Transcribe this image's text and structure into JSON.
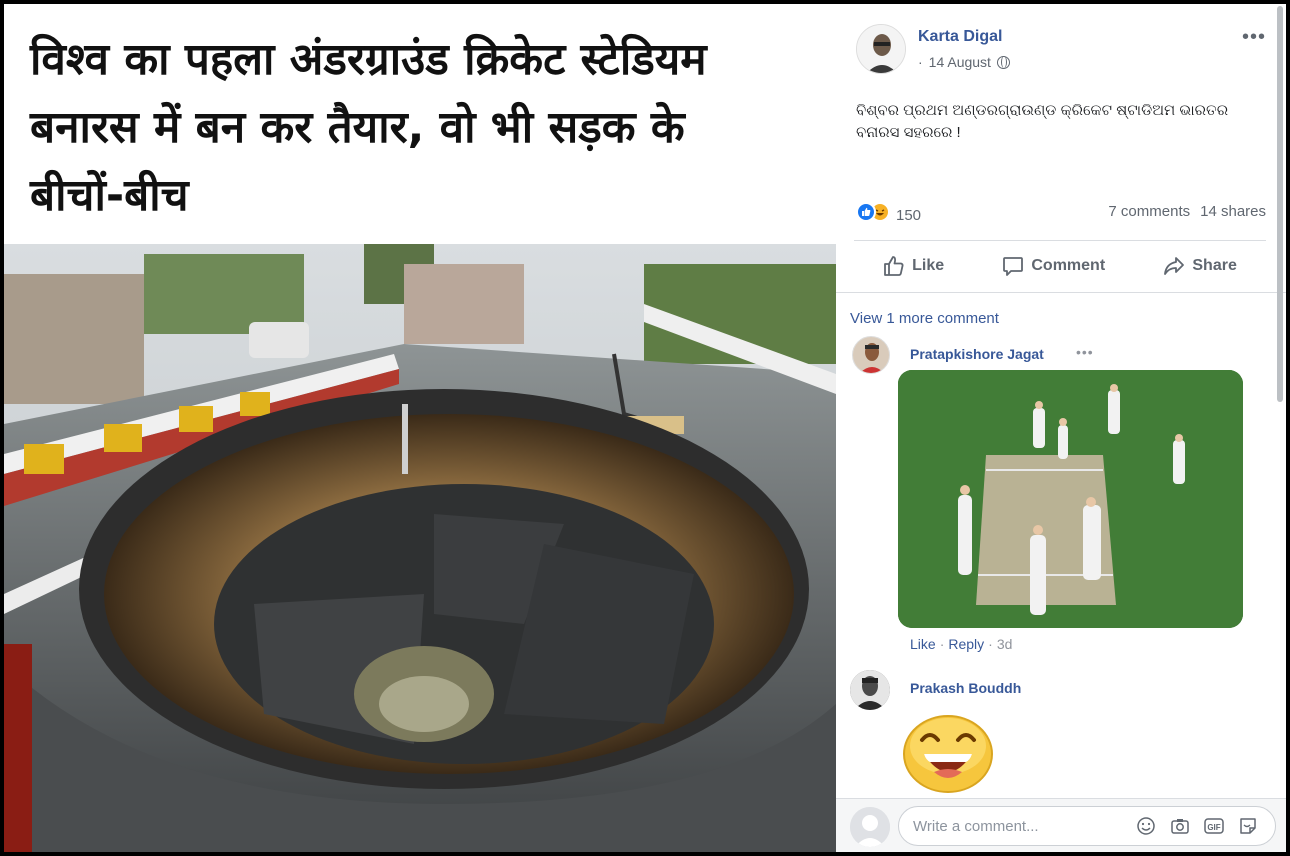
{
  "headline": {
    "lines": [
      "विश्व का पहला अंडरग्राउंड क्रिकेट स्टेडियम",
      "बनारस में बन कर तैयार, वो भी सड़क के",
      "बीचों-बीच"
    ]
  },
  "post": {
    "author": "Karta Digal",
    "date": "14 August",
    "dot": "·",
    "privacy_icon": "globe-icon",
    "more_label": "•••",
    "text": "ବିଶ୍ବର ପ୍ରଥମ ଅଣ୍ଡରଗ୍ରାଉଣ୍ଡ କ୍ରିକେଟ ଷ୍ଟାଡିଅମ ଭାରତର ବନାରସ ସହରରେ !",
    "reaction_count": "150",
    "comments_count": "7 comments",
    "shares_count": "14 shares"
  },
  "actions": {
    "like": "Like",
    "comment": "Comment",
    "share": "Share"
  },
  "comments": {
    "view_more": "View 1 more comment",
    "items": [
      {
        "author": "Pratapkishore Jagat",
        "more": "•••",
        "like": "Like",
        "reply": "Reply",
        "sep": "·",
        "time": "3d"
      },
      {
        "author": "Prakash Bouddh"
      }
    ]
  },
  "composer": {
    "placeholder": "Write a comment..."
  },
  "colors": {
    "link": "#385898",
    "muted": "#606770",
    "like_blue": "#1877f2",
    "haha_yellow": "#f7b125"
  }
}
